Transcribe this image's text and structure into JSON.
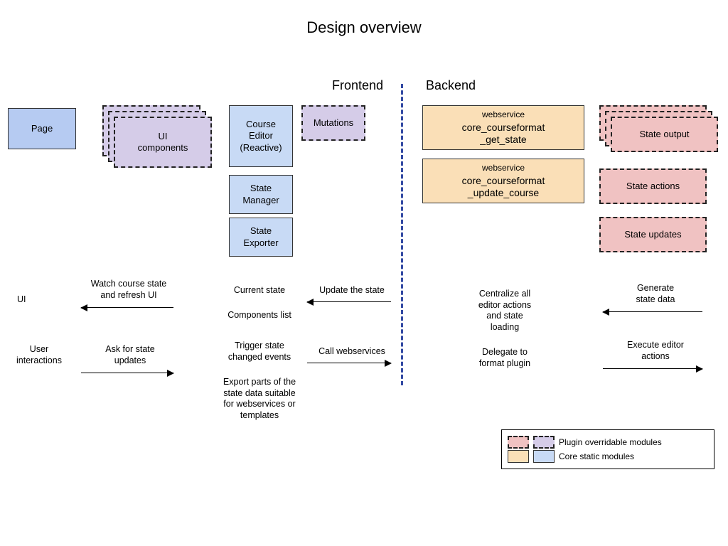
{
  "title": "Design overview",
  "sections": {
    "frontend": "Frontend",
    "backend": "Backend"
  },
  "frontend": {
    "page": "Page",
    "ui_components": "UI\ncomponents",
    "course_editor": "Course\nEditor\n(Reactive)",
    "mutations": "Mutations",
    "state_manager": "State\nManager",
    "state_exporter": "State\nExporter"
  },
  "backend": {
    "ws1_label": "webservice",
    "ws1_name": "core_courseformat\n_get_state",
    "ws2_label": "webservice",
    "ws2_name": "core_courseformat\n_update_course",
    "state_output": "State output",
    "state_actions": "State actions",
    "state_updates": "State updates"
  },
  "annotations": {
    "ui": "UI",
    "watch": "Watch course state\nand refresh UI",
    "user_interactions": "User\ninteractions",
    "ask_updates": "Ask for state\nupdates",
    "current_state": "Current state",
    "components_list": "Components list",
    "trigger_events": "Trigger state\nchanged events",
    "export_parts": "Export parts of the\nstate data suitable\nfor webservices or\ntemplates",
    "update_state": "Update the state",
    "call_ws": "Call webservices",
    "centralize": "Centralize all\neditor actions\nand state\nloading",
    "delegate": "Delegate to\nformat plugin",
    "generate": "Generate\nstate data",
    "execute": "Execute editor\nactions"
  },
  "legend": {
    "overridable": "Plugin overridable modules",
    "core": "Core static modules"
  }
}
